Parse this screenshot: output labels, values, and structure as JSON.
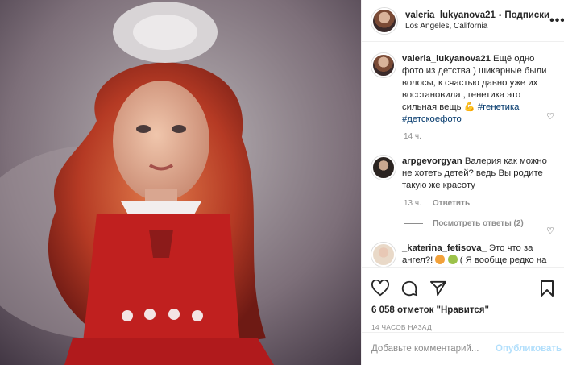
{
  "post": {
    "author": "valeria_lukyanova21",
    "follow_label": "Подписки",
    "separator": "•",
    "location": "Los Angeles, California",
    "more": "•••"
  },
  "caption": {
    "author": "valeria_lukyanova21",
    "text": " Ещё одно фото из детства ) шикарные были волосы, к счастью давно уже их восстановила , генетика это сильная вещь 💪 ",
    "tags": "#генетика #детскоефото",
    "time": "14 ч."
  },
  "comments": [
    {
      "author": "arpgevorgyan",
      "text": " Валерия как можно не хотеть детей? ведь Вы родите такую же красоту",
      "time": "13 ч.",
      "reply_label": "Ответить",
      "view_replies": "Посмотреть ответы (2)"
    },
    {
      "author": "_katerina_fetisova_",
      "text_part1": " Это что за ангел?! ",
      "text_part2": " ( Я вообще редко на детей реагирую, но тут сложно пройти мимо)) "
    }
  ],
  "actions": {
    "likes": "6 058 отметок \"Нравится\"",
    "posted_ago": "14 ЧАСОВ НАЗАД"
  },
  "composer": {
    "placeholder": "Добавьте комментарий...",
    "post_label": "Опубликовать"
  },
  "colors": {
    "link": "#00376b",
    "muted": "#8e8e8e",
    "post_button_disabled": "#b2dffc"
  }
}
